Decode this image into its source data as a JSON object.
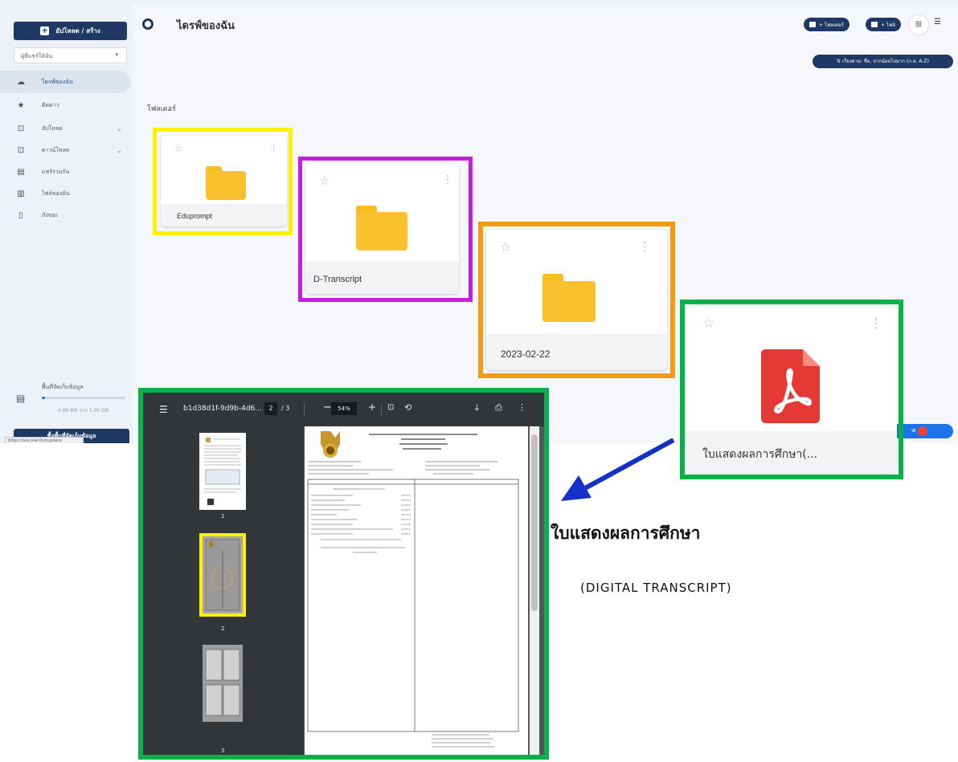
{
  "app": {
    "title": "ไดรฟ์ของฉัน",
    "new_button": "อัปโหลด / สร้าง",
    "filter_select": "ผู้ที่แชร์ให้ฉัน",
    "sidebar_items": [
      {
        "label": "ไดรฟ์ของฉัน",
        "icon": "cloud-icon",
        "active": true
      },
      {
        "label": "ติดดาว",
        "icon": "star-icon"
      },
      {
        "label": "อัปโหลด",
        "icon": "upload-icon",
        "chevron": true
      },
      {
        "label": "ดาวน์โหลด",
        "icon": "download-icon",
        "chevron": true
      },
      {
        "label": "แชร์ร่วมกัน",
        "icon": "shared-icon"
      },
      {
        "label": "ไฟล์ของฉัน",
        "icon": "files-icon"
      },
      {
        "label": "ถังขยะ",
        "icon": "trash-icon"
      }
    ],
    "storage_label": "พื้นที่จัดเก็บข้อมูล",
    "storage_used": "4.86 MB จาก 1.00 GB",
    "buy_storage": "ซื้อพื้นที่จัดเก็บข้อมูล",
    "status_url": "https://oss.one.th/myplace",
    "new_folder_pill": "+ โฟลเดอร์",
    "new_file_pill": "+ ไฟล์",
    "sort_pill": "⇅ เรียงตาม: ชื่อ, จากน้อยไปมาก (ก-ฮ, A-Z)",
    "folders_heading": "โฟลเดอร์"
  },
  "items": [
    {
      "name": "Eduprompt",
      "type": "folder"
    },
    {
      "name": "D-Transcript",
      "type": "folder"
    },
    {
      "name": "2023-02-22",
      "type": "folder"
    },
    {
      "name": "ใบแสดงผลการศึกษา(...",
      "type": "pdf"
    }
  ],
  "highlight_colors": {
    "yellow": "#fff200",
    "magenta": "#c61ee0",
    "orange": "#f39c12",
    "green": "#0ab04a",
    "arrow": "#1430c8"
  },
  "viewer": {
    "file_name": "b1d38d1f-9d9b-4d6...",
    "current_page": "2",
    "total_pages": "/ 3",
    "zoom": "54%",
    "thumbnails": [
      "1",
      "2",
      "3"
    ]
  },
  "annotation": {
    "title": "ใบแสดงผลการศึกษา",
    "subtitle": "(DIGITAL TRANSCRIPT)"
  }
}
